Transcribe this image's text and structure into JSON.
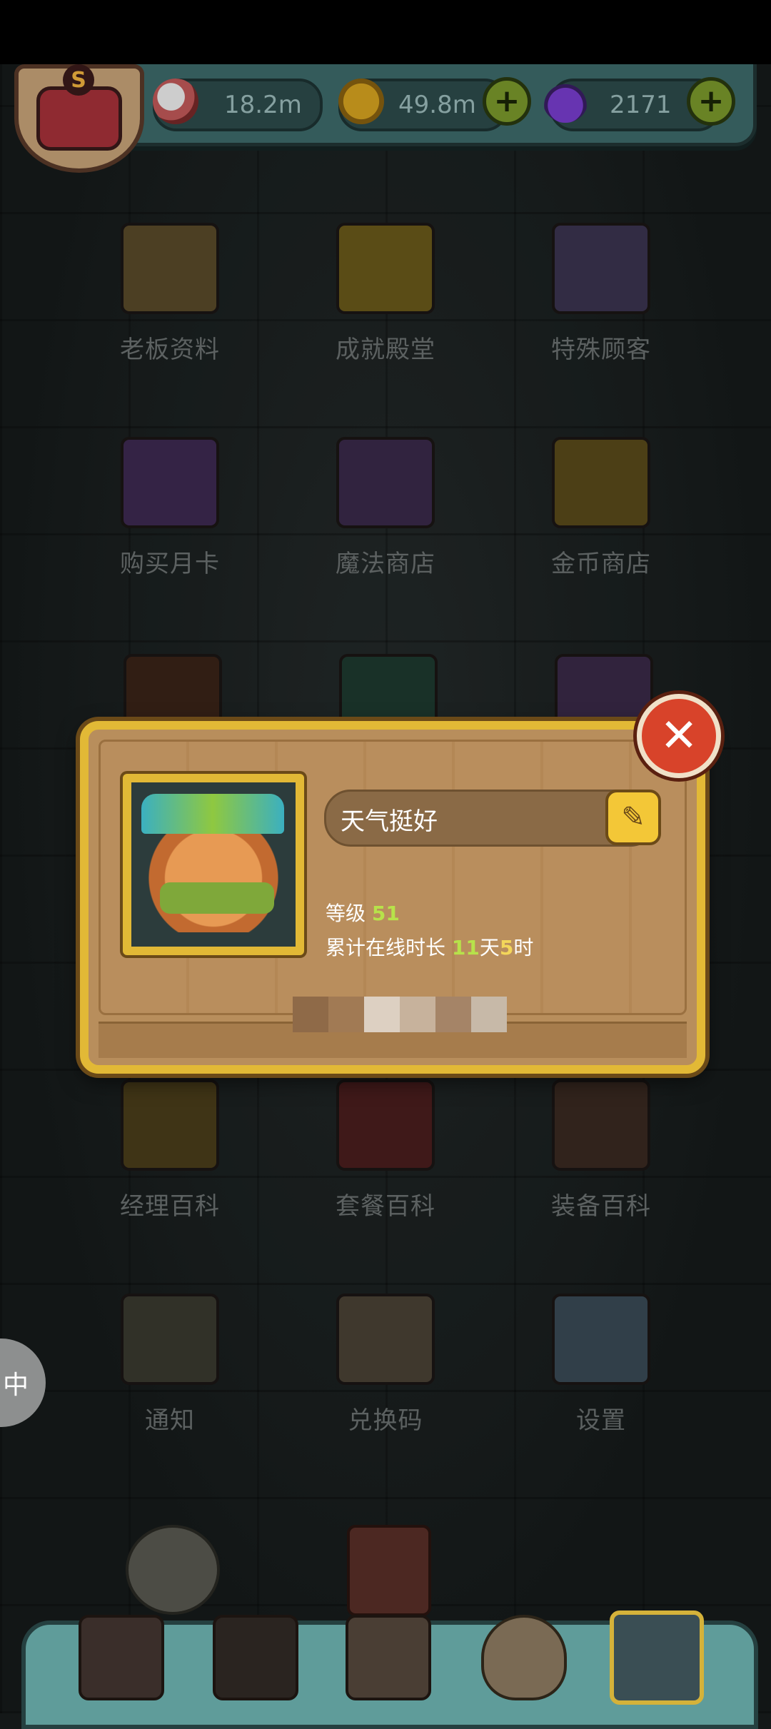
{
  "resources": {
    "eyes": {
      "value": "18.2m",
      "icon": "eyeball-icon"
    },
    "coins": {
      "value": "49.8m",
      "icon": "coin-icon"
    },
    "potions": {
      "value": "2171",
      "icon": "potion-icon"
    }
  },
  "avatar": {
    "badge": "S"
  },
  "menu": [
    {
      "label": "老板资料",
      "icon": "profile-card-icon",
      "color": "#5a4a2a"
    },
    {
      "label": "成就殿堂",
      "icon": "trophy-icon",
      "color": "#6a5a1a"
    },
    {
      "label": "特殊顾客",
      "icon": "customer-book-icon",
      "color": "#3b3450"
    },
    {
      "label": "购买月卡",
      "icon": "month-card-icon",
      "color": "#3e2a52"
    },
    {
      "label": "魔法商店",
      "icon": "magic-potion-icon",
      "color": "#3a2a4a"
    },
    {
      "label": "金币商店",
      "icon": "coin-stack-icon",
      "color": "#5a4a1a"
    },
    {
      "label": "经理百科",
      "icon": "manager-book-icon",
      "color": "#4a3e1a"
    },
    {
      "label": "套餐百科",
      "icon": "meal-book-icon",
      "color": "#4a1e1e"
    },
    {
      "label": "装备百科",
      "icon": "equipment-book-icon",
      "color": "#3a2a22"
    },
    {
      "label": "通知",
      "icon": "megaphone-icon",
      "color": "#3a3a30"
    },
    {
      "label": "兑换码",
      "icon": "scroll-icon",
      "color": "#4a4236"
    },
    {
      "label": "设置",
      "icon": "gear-icon",
      "color": "#3a4a56"
    }
  ],
  "profile": {
    "name": "天气挺好",
    "level_label": "等级",
    "level": "51",
    "online_label": "累计在线时长",
    "online_days": "11",
    "day_unit": "天",
    "online_hours": "5",
    "hour_unit": "时",
    "close": "✕",
    "edit": "✎"
  },
  "float_tab": "中",
  "bottom_nav": [
    "restaurant-icon",
    "monster-icon",
    "book-icon",
    "money-bag-icon",
    "grid-menu-icon"
  ]
}
